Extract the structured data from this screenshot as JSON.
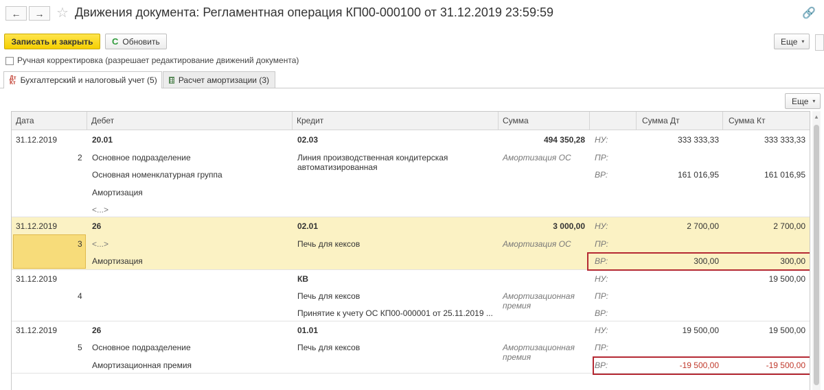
{
  "window": {
    "title": "Движения документа: Регламентная операция КП00-000100 от 31.12.2019 23:59:59",
    "back_glyph": "←",
    "forward_glyph": "→",
    "star_glyph": "☆",
    "link_glyph": "🔗"
  },
  "toolbar": {
    "save_close_label": "Записать и закрыть",
    "refresh_label": "Обновить",
    "more_label": "Еще",
    "refresh_glyph": "C",
    "caret_glyph": "▾"
  },
  "manual_correction": {
    "label": "Ручная корректировка (разрешает редактирование движений документа)",
    "checked": false
  },
  "tabs": [
    {
      "label": "Бухгалтерский и налоговый учет (5)",
      "icon": "dt-kt-icon",
      "icon_top": "Дт",
      "icon_bottom": "Кт",
      "active": true
    },
    {
      "label": "Расчет амортизации (3)",
      "icon": "table-icon",
      "active": false
    }
  ],
  "table_toolbar": {
    "more_label": "Еще"
  },
  "table": {
    "columns": [
      "Дата",
      "Дебет",
      "Кредит",
      "Сумма",
      "",
      "Сумма Дт",
      "Сумма Кт"
    ],
    "rows": [
      {
        "date": "31.12.2019",
        "number": "2",
        "debit": [
          "20.01",
          "Основное подразделение",
          "Основная номенклатурная группа",
          "Амортизация",
          "<...>"
        ],
        "credit": [
          "02.03",
          "Линия производственная кондитерская автоматизированная"
        ],
        "amount": "494 350,28",
        "content": "Амортизация ОС",
        "labels": [
          "НУ:",
          "ПР:",
          "ВР:"
        ],
        "sum_dt": [
          "333 333,33",
          "",
          "161 016,95"
        ],
        "sum_kt": [
          "333 333,33",
          "",
          "161 016,95"
        ]
      },
      {
        "date": "31.12.2019",
        "number": "3",
        "debit": [
          "26",
          "<...>",
          "Амортизация"
        ],
        "credit": [
          "02.01",
          "Печь для кексов"
        ],
        "amount": "3 000,00",
        "content": "Амортизация ОС",
        "labels": [
          "НУ:",
          "ПР:",
          "ВР:"
        ],
        "sum_dt": [
          "2 700,00",
          "",
          "300,00"
        ],
        "sum_kt": [
          "2 700,00",
          "",
          "300,00"
        ]
      },
      {
        "date": "31.12.2019",
        "number": "4",
        "debit": [
          "",
          "",
          ""
        ],
        "credit": [
          "КВ",
          "Печь для кексов",
          "Принятие к учету ОС КП00-000001 от 25.11.2019 ..."
        ],
        "amount": "",
        "content": "Амортизационная премия",
        "labels": [
          "НУ:",
          "ПР:",
          "ВР:"
        ],
        "sum_dt": [
          "",
          "",
          ""
        ],
        "sum_kt": [
          "19 500,00",
          "",
          ""
        ]
      },
      {
        "date": "31.12.2019",
        "number": "5",
        "debit": [
          "26",
          "Основное подразделение",
          "Амортизационная премия"
        ],
        "credit": [
          "01.01",
          "Печь для кексов"
        ],
        "amount": "",
        "content": "Амортизационная премия",
        "labels": [
          "НУ:",
          "ПР:",
          "ВР:"
        ],
        "sum_dt": [
          "19 500,00",
          "",
          "-19 500,00"
        ],
        "sum_kt": [
          "19 500,00",
          "",
          "-19 500,00"
        ]
      }
    ]
  },
  "colors": {
    "primary_button": "#f5cf00",
    "selected_row": "#fbf2c4",
    "highlight_border": "#b42832",
    "negative_value": "#c0392b"
  }
}
